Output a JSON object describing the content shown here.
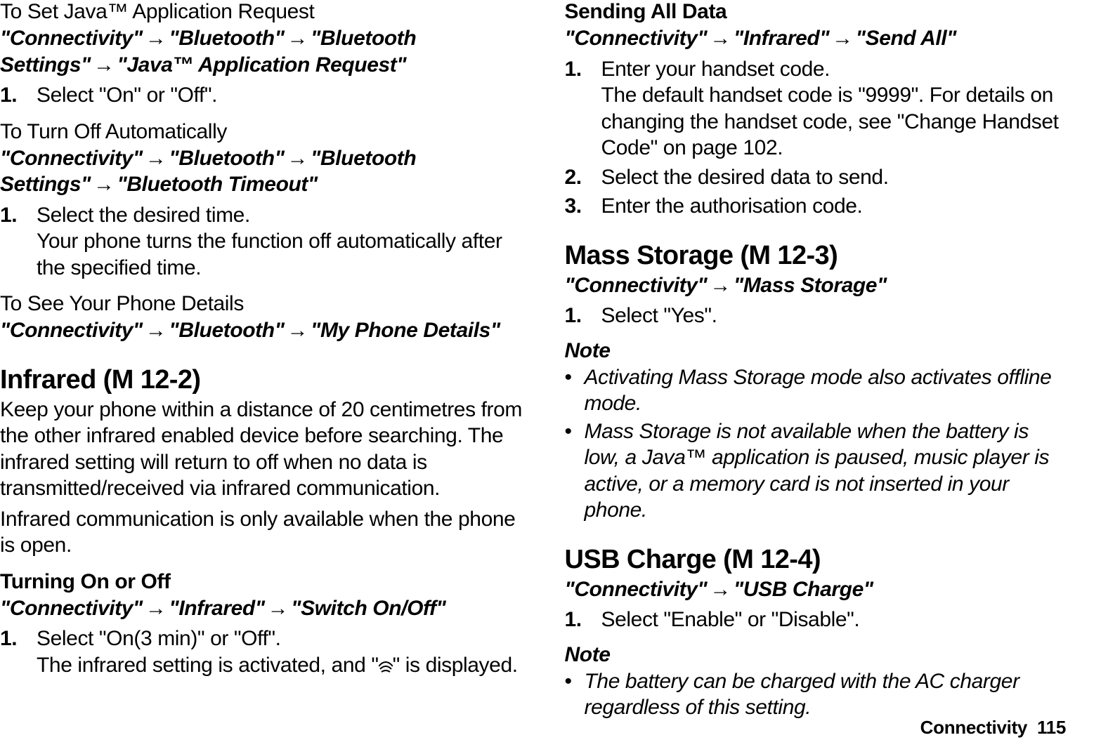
{
  "left": {
    "sec1": {
      "title": "To Set Java™ Application Request",
      "path_parts": [
        "\"Connectivity\"",
        "\"Bluetooth\"",
        "\"Bluetooth Settings\"",
        "\"Java™ Application Request\""
      ],
      "step1": "Select \"On\" or \"Off\"."
    },
    "sec2": {
      "title": "To Turn Off Automatically",
      "path_parts": [
        "\"Connectivity\"",
        "\"Bluetooth\"",
        "\"Bluetooth Settings\"",
        "\"Bluetooth Timeout\""
      ],
      "step1": "Select the desired time.",
      "step1_sub": "Your phone turns the function off automatically after the specified time."
    },
    "sec3": {
      "title": "To See Your Phone Details",
      "path_parts": [
        "\"Connectivity\"",
        "\"Bluetooth\"",
        "\"My Phone Details\""
      ]
    },
    "infrared": {
      "heading": "Infrared",
      "menucode": " (M 12-2)",
      "intro": "Keep your phone within a distance of 20 centimetres from the other infrared enabled device before searching. The infrared setting will return to off when no data is transmitted/received via infrared communication.",
      "intro2": "Infrared communication is only available when the phone is open.",
      "onoff": {
        "title": "Turning On or Off",
        "path_parts": [
          "\"Connectivity\"",
          "\"Infrared\"",
          "\"Switch On/Off\""
        ],
        "step1": "Select \"On(3 min)\" or \"Off\".",
        "step1_sub_a": "The infrared setting is activated, and \"",
        "step1_sub_b": "\" is displayed."
      }
    }
  },
  "right": {
    "sendall": {
      "title": "Sending All Data",
      "path_parts": [
        "\"Connectivity\"",
        "\"Infrared\"",
        "\"Send All\""
      ],
      "step1": "Enter your handset code.",
      "step1_sub": "The default handset code is \"9999\". For details on changing the handset code, see \"Change Handset Code\" on page 102.",
      "step2": "Select the desired data to send.",
      "step3": "Enter the authorisation code."
    },
    "mass": {
      "heading": "Mass Storage",
      "menucode": " (M 12-3)",
      "path_parts": [
        "\"Connectivity\"",
        "\"Mass Storage\""
      ],
      "step1": "Select \"Yes\".",
      "note_label": "Note",
      "note1": "Activating Mass Storage mode also activates offline mode.",
      "note2": "Mass Storage is not available when the battery is low, a Java™ application is paused, music player is active, or a memory card is not inserted in your phone."
    },
    "usb": {
      "heading": "USB Charge",
      "menucode": " (M 12-4)",
      "path_parts": [
        "\"Connectivity\"",
        "\"USB Charge\""
      ],
      "step1": "Select \"Enable\" or \"Disable\".",
      "note_label": "Note",
      "note1": "The battery can be charged with the AC charger regardless of this setting."
    }
  },
  "footer": {
    "section": "Connectivity",
    "page": "115"
  }
}
